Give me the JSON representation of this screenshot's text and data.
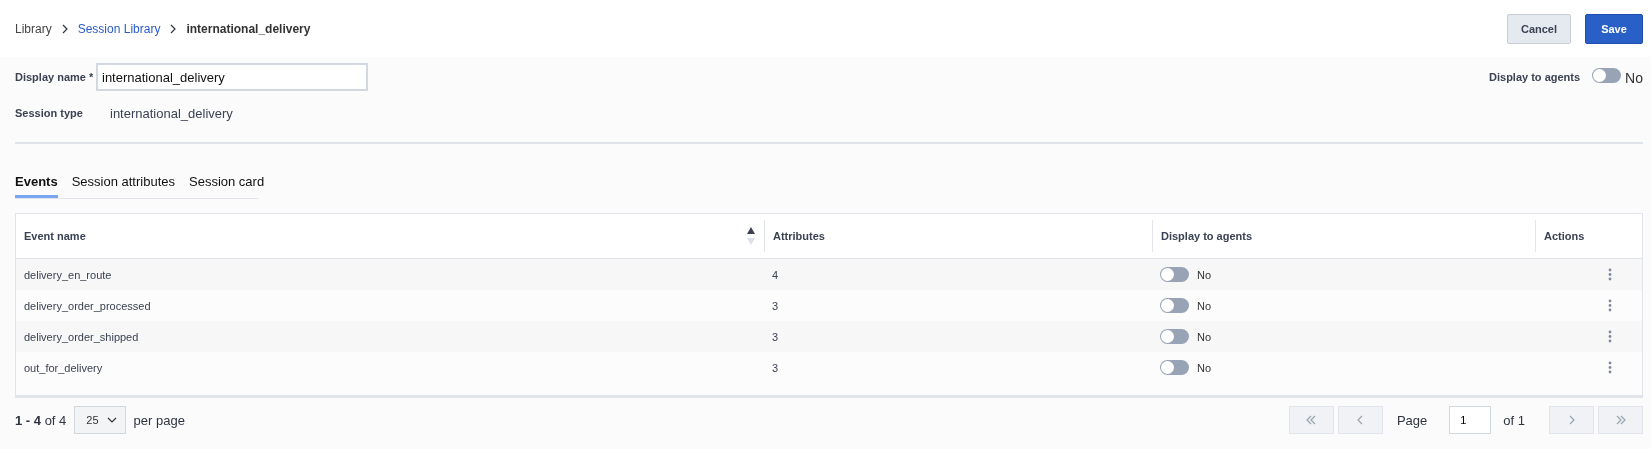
{
  "breadcrumb": [
    {
      "label": "Library",
      "kind": "plain"
    },
    {
      "label": "Session Library",
      "kind": "link"
    },
    {
      "label": "international_delivery",
      "kind": "current"
    }
  ],
  "buttons": {
    "cancel": "Cancel",
    "save": "Save"
  },
  "display_name": {
    "label": "Display name *",
    "value": "international_delivery"
  },
  "display_to_agents": {
    "label": "Display to agents",
    "on": false,
    "state_label": "No"
  },
  "session_type": {
    "label": "Session type",
    "value": "international_delivery"
  },
  "tabs": [
    {
      "label": "Events",
      "selected": true
    },
    {
      "label": "Session attributes",
      "selected": false
    },
    {
      "label": "Session card",
      "selected": false
    }
  ],
  "table": {
    "columns": [
      {
        "label": "Event name",
        "sorted": true
      },
      {
        "label": "Attributes",
        "sorted": false
      },
      {
        "label": "Display to agents",
        "sorted": false
      },
      {
        "label": "Actions",
        "sorted": false
      }
    ],
    "rows": [
      {
        "event_name": "delivery_en_route",
        "attributes": "4",
        "display_on": false,
        "display_label": "No"
      },
      {
        "event_name": "delivery_order_processed",
        "attributes": "3",
        "display_on": false,
        "display_label": "No"
      },
      {
        "event_name": "delivery_order_shipped",
        "attributes": "3",
        "display_on": false,
        "display_label": "No"
      },
      {
        "event_name": "out_for_delivery",
        "attributes": "3",
        "display_on": false,
        "display_label": "No"
      }
    ]
  },
  "pagination": {
    "range": "**1 - 4** of 4",
    "page_size": "25",
    "per_page": "per page",
    "page_label": "Page",
    "page": "1",
    "of_pages": "of 1"
  }
}
